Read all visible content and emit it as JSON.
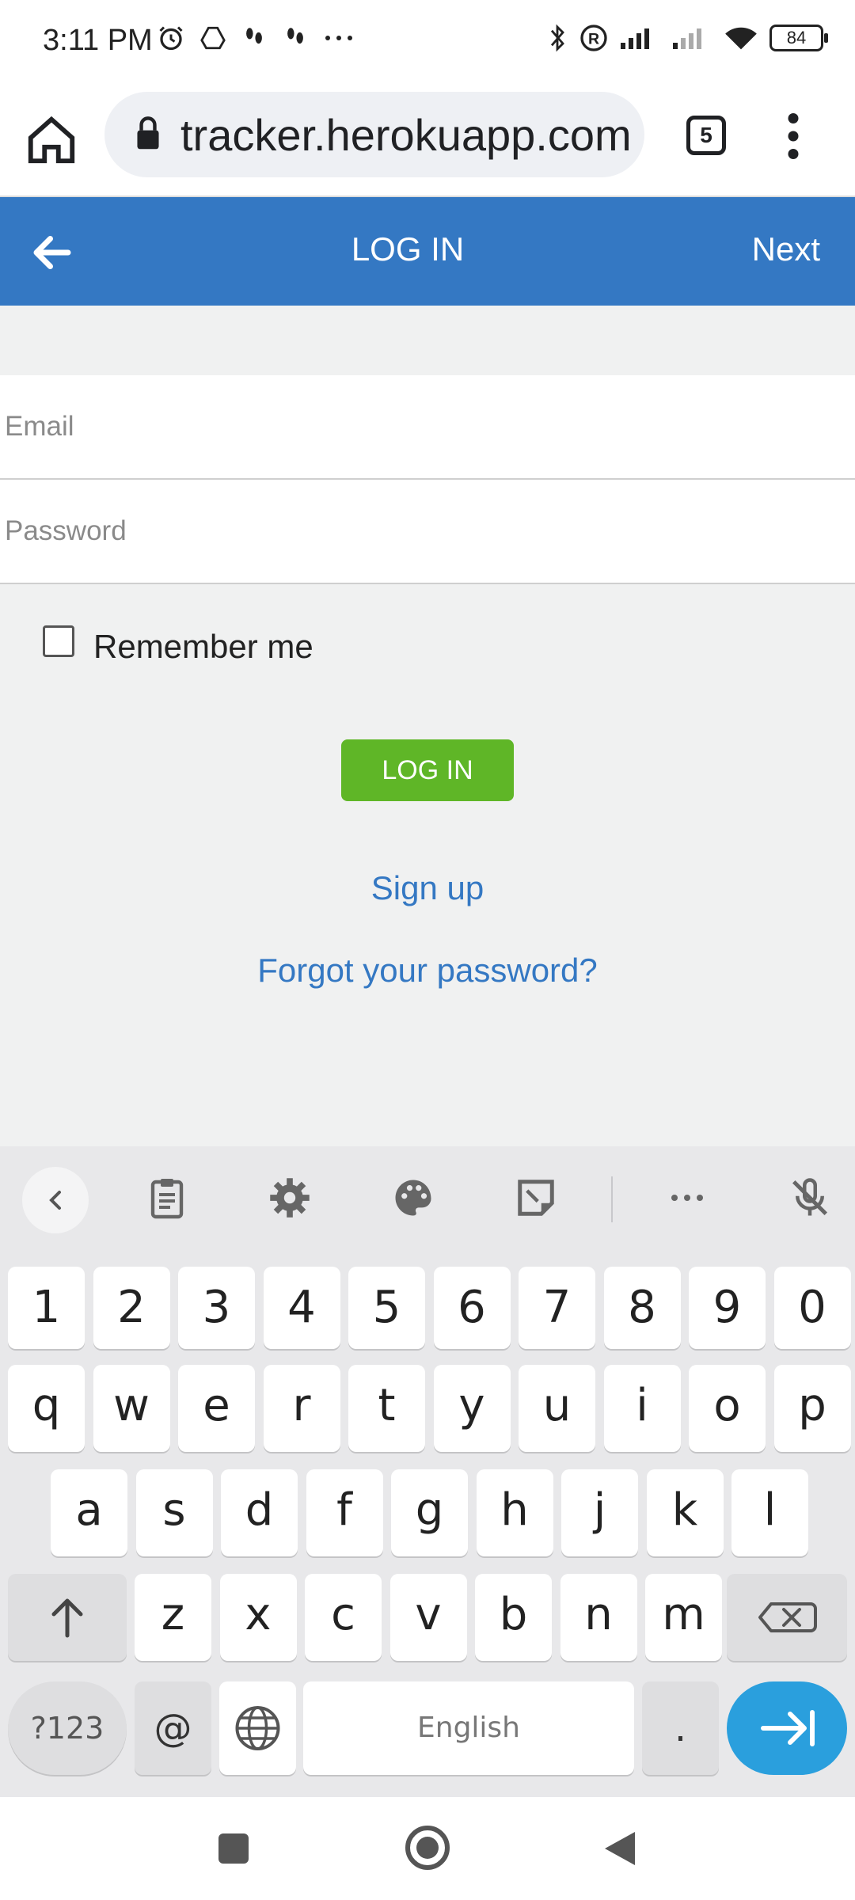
{
  "status_bar": {
    "time": "3:11 PM",
    "battery": "84"
  },
  "browser": {
    "url": "tracker.herokuapp.com",
    "tab_count": "5"
  },
  "header": {
    "title": "LOG IN",
    "next_label": "Next"
  },
  "form": {
    "email_placeholder": "Email",
    "password_placeholder": "Password",
    "remember_label": "Remember me",
    "login_button": "LOG IN",
    "signup_link": "Sign up",
    "forgot_link": "Forgot your password?"
  },
  "keyboard": {
    "number_row": [
      "1",
      "2",
      "3",
      "4",
      "5",
      "6",
      "7",
      "8",
      "9",
      "0"
    ],
    "row1": [
      "q",
      "w",
      "e",
      "r",
      "t",
      "y",
      "u",
      "i",
      "o",
      "p"
    ],
    "row2": [
      "a",
      "s",
      "d",
      "f",
      "g",
      "h",
      "j",
      "k",
      "l"
    ],
    "row3": [
      "z",
      "x",
      "c",
      "v",
      "b",
      "n",
      "m"
    ],
    "symbols_key": "?123",
    "at_key": "@",
    "space_label": "English",
    "period_key": "."
  },
  "colors": {
    "header": "#3478c3",
    "login_button": "#5fb627",
    "link": "#3478c3",
    "enter_key": "#2a9fdd"
  },
  "icons": [
    "home-icon",
    "lock-icon",
    "tabs-icon",
    "menu-icon",
    "back-arrow-icon",
    "clipboard-icon",
    "gear-icon",
    "palette-icon",
    "sticker-icon",
    "more-icon",
    "mic-off-icon",
    "shift-icon",
    "backspace-icon",
    "globe-icon",
    "enter-icon",
    "recents-icon",
    "home-nav-icon",
    "back-nav-icon"
  ]
}
